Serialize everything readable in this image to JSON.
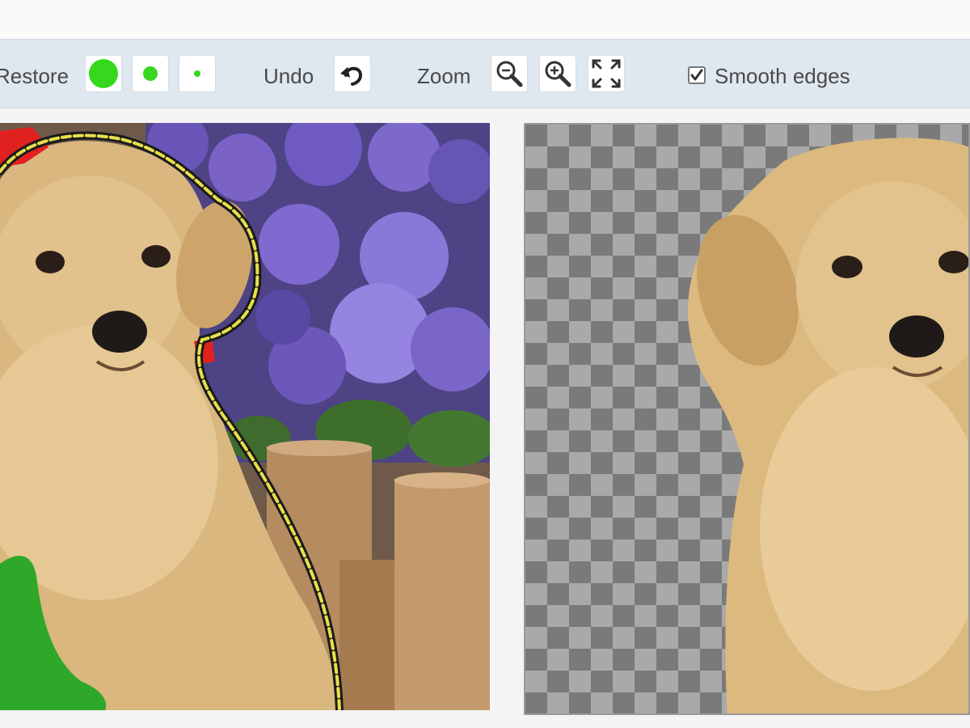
{
  "toolbar": {
    "restore_label": "Restore",
    "brush_sizes": [
      "large",
      "medium",
      "small"
    ],
    "undo_label": "Undo",
    "zoom_label": "Zoom",
    "smooth_edges_label": "Smooth edges",
    "smooth_edges_checked": true
  },
  "icons": {
    "undo": "undo-arrow-icon",
    "zoom_out": "zoom-out-icon",
    "zoom_in": "zoom-in-icon",
    "fit": "fit-to-screen-icon",
    "checkbox": "checkbox-icon"
  },
  "colors": {
    "toolbar_bg": "#dfe7ef",
    "brush_green": "#35d81d",
    "selection_outline": "#e8e04a",
    "mark_red": "#e12020",
    "mark_green": "#2fa82a",
    "checker_dark": "#7a7a7a",
    "checker_light": "#a9a9a9"
  }
}
